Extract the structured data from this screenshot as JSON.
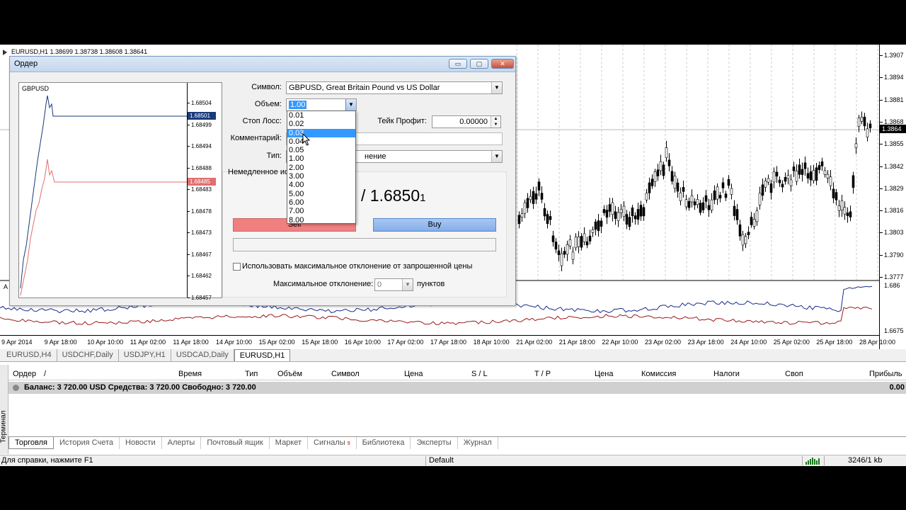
{
  "chart": {
    "title": "EURUSD,H1  1.38699 1.38738 1.38608 1.38641",
    "price_ticks": [
      "1.3907",
      "1.3894",
      "1.3881",
      "1.3868",
      "1.3855",
      "1.3842",
      "1.3829",
      "1.3816",
      "1.3803",
      "1.3790",
      "1.3777"
    ],
    "current_price": "1.3864",
    "indicator_ticks": [
      "1.686",
      "1.6675"
    ],
    "time_ticks": [
      "9 Apr 2014",
      "9 Apr 18:00",
      "10 Apr 10:00",
      "11 Apr 02:00",
      "11 Apr 18:00",
      "14 Apr 10:00",
      "15 Apr 02:00",
      "15 Apr 18:00",
      "16 Apr 10:00",
      "17 Apr 02:00",
      "17 Apr 18:00",
      "18 Apr 10:00",
      "21 Apr 02:00",
      "21 Apr 18:00",
      "22 Apr 10:00",
      "23 Apr 02:00",
      "23 Apr 18:00",
      "24 Apr 10:00",
      "25 Apr 02:00",
      "25 Apr 18:00",
      "28 Apr 10:00"
    ],
    "indicator_corner_label": "A",
    "colors": {
      "indicator_blue": "#1a2a8a",
      "indicator_red": "#9a1a1a"
    }
  },
  "chart_tabs": [
    "EURUSD,H4",
    "USDCHF,Daily",
    "USDJPY,H1",
    "USDCAD,Daily",
    "EURUSD,H1"
  ],
  "chart_tabs_active": "EURUSD,H1",
  "dialog": {
    "title": "Ордер",
    "minimize_icon": "▭",
    "maximize_icon": "▢",
    "close_icon": "✕",
    "mini_chart": {
      "symbol": "GBPUSD",
      "ticks": [
        "1.68504",
        "1.68499",
        "1.68494",
        "1.68488",
        "1.68483",
        "1.68478",
        "1.68473",
        "1.68467",
        "1.68462",
        "1.68457"
      ],
      "ask_label": "1.68501",
      "bid_label": "1.68485",
      "colors": {
        "ask": "#1a3a7a",
        "bid": "#e07070"
      }
    },
    "symbol_label": "Символ:",
    "symbol_value": "GBPUSD, Great Britain Pound vs US Dollar",
    "volume_label": "Объем:",
    "volume_value": "1.00",
    "stoploss_label": "Стоп Лосс:",
    "takeprofit_label": "Тейк Профит:",
    "takeprofit_value": "0.00000",
    "comment_label": "Комментарий:",
    "type_label": "Тип:",
    "type_value_partial": "нение",
    "exec_label": "Немедленное испо",
    "price_text": "/ 1.6850",
    "price_small": "1",
    "sell_label": "Sell",
    "buy_label": "Buy",
    "deviation_checkbox_label": "Использовать максимальное отклонение от запрошенной цены",
    "max_deviation_label": "Максимальное отклонение:",
    "max_deviation_value": "0",
    "points_label": "пунктов",
    "volume_options": [
      "0.01",
      "0.02",
      "0.03",
      "0.04",
      "0.05",
      "1.00",
      "2.00",
      "3.00",
      "4.00",
      "5.00",
      "6.00",
      "7.00",
      "8.00"
    ],
    "volume_selected_index": 2
  },
  "terminal": {
    "side_label": "Терминал",
    "columns": [
      "Ордер",
      "/",
      "Время",
      "Тип",
      "Объём",
      "Символ",
      "Цена",
      "S / L",
      "T / P",
      "Цена",
      "Комиссия",
      "Налоги",
      "Своп",
      "Прибыль"
    ],
    "balance_text": "Баланс: 3 720.00 USD  Средства: 3 720.00  Свободно: 3 720.00",
    "profit_value": "0.00",
    "tabs": [
      "Торговля",
      "История Счета",
      "Новости",
      "Алерты",
      "Почтовый ящик",
      "Маркет",
      "Сигналы",
      "Библиотека",
      "Эксперты",
      "Журнал"
    ],
    "signals_badge": "9",
    "active_tab": "Торговля"
  },
  "statusbar": {
    "help_text": "Для справки, нажмите F1",
    "profile": "Default",
    "traffic": "3246/1 kb"
  }
}
